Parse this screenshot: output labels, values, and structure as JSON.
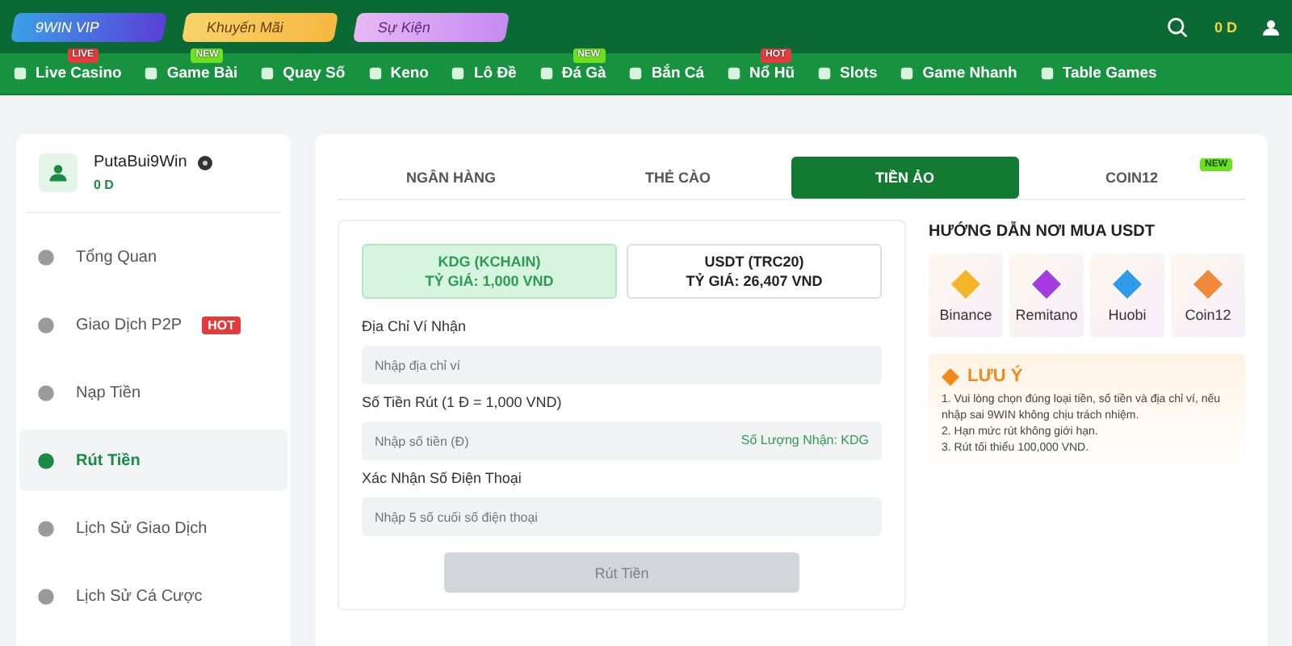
{
  "promos": [
    {
      "label": "9WIN VIP",
      "kind": "vip"
    },
    {
      "label": "Khuyến Mãi",
      "kind": "gift"
    },
    {
      "label": "Sự Kiện",
      "kind": "event"
    }
  ],
  "balance": "0 D",
  "nav": [
    {
      "label": "Live Casino",
      "badge": {
        "text": "LIVE",
        "color": "#e23b3b"
      }
    },
    {
      "label": "Game Bài",
      "badge": {
        "text": "NEW",
        "color": "#6ee01f"
      }
    },
    {
      "label": "Quay Số"
    },
    {
      "label": "Keno"
    },
    {
      "label": "Lô Đề"
    },
    {
      "label": "Đá Gà",
      "badge": {
        "text": "NEW",
        "color": "#6ee01f"
      }
    },
    {
      "label": "Bắn Cá"
    },
    {
      "label": "Nổ Hũ",
      "badge": {
        "text": "HOT",
        "color": "#e23b3b"
      }
    },
    {
      "label": "Slots"
    },
    {
      "label": "Game Nhanh"
    },
    {
      "label": "Table Games"
    }
  ],
  "user": {
    "name": "PutaBui9Win",
    "balance": "0 D"
  },
  "sidebar": {
    "items": [
      {
        "label": "Tổng Quan",
        "selected": false
      },
      {
        "label": "Giao Dịch P2P",
        "selected": false,
        "badge": "HOT"
      },
      {
        "label": "Nạp Tiền",
        "selected": false
      },
      {
        "label": "Rút Tiền",
        "selected": true
      },
      {
        "label": "Lịch Sử Giao Dịch",
        "selected": false
      },
      {
        "label": "Lịch Sử Cá Cược",
        "selected": false
      }
    ]
  },
  "tabs": [
    {
      "label": "NGÂN HÀNG",
      "selected": false
    },
    {
      "label": "THẺ CÀO",
      "selected": false
    },
    {
      "label": "TIỀN ẢO",
      "selected": true
    },
    {
      "label": "COIN12",
      "selected": false,
      "badge": "NEW"
    }
  ],
  "coins": [
    {
      "name": "KDG (KCHAIN)",
      "rate": "TỶ GIÁ: 1,000 VND",
      "selected": true
    },
    {
      "name": "USDT (TRC20)",
      "rate": "TỶ GIÁ: 26,407 VND",
      "selected": false
    }
  ],
  "fields": [
    {
      "label": "Địa Chỉ Ví Nhận",
      "placeholder": "Nhập địa chỉ ví"
    },
    {
      "label": "Số Tiền Rút (1 Đ = 1,000 VND)",
      "placeholder": "Nhập số tiền (Đ)",
      "hint": "Số Lượng Nhận: KDG"
    },
    {
      "label": "Xác Nhận Số Điện Thoại",
      "placeholder": "Nhập 5 số cuối số điện thoại"
    }
  ],
  "submit": {
    "label": "Rút Tiền",
    "disabled": true
  },
  "guide": {
    "title": "HƯỚNG DẪN NƠI MUA USDT",
    "exchanges": [
      {
        "name": "Binance",
        "color": "#f3b52a"
      },
      {
        "name": "Remitano",
        "color": "#a33be0"
      },
      {
        "name": "Huobi",
        "color": "#2d9be8"
      },
      {
        "name": "Coin12",
        "color": "#f08a3a"
      }
    ]
  },
  "notice": {
    "title": "LƯU Ý",
    "items": [
      "1. Vui lòng chọn đúng loại tiền, số tiền và địa chỉ ví, nếu nhập sai 9WIN không chịu trách nhiệm.",
      "2. Hạn mức rút không giới hạn.",
      "3. Rút tối thiểu 100,000 VND."
    ]
  }
}
